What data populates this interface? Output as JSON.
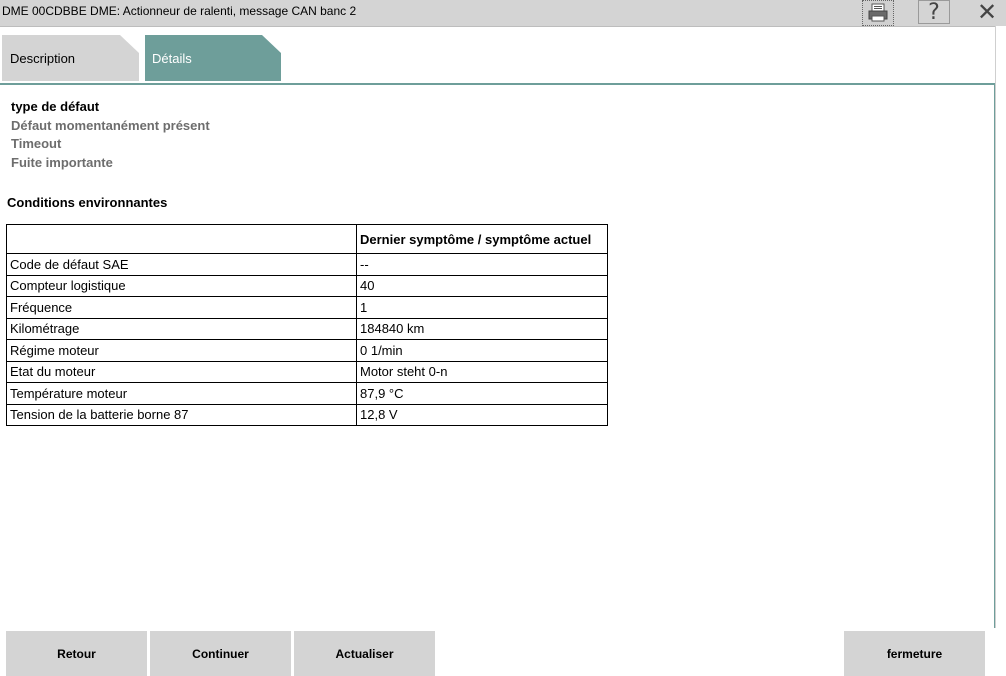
{
  "window": {
    "title": "DME 00CDBBE DME: Actionneur de ralenti, message CAN banc 2"
  },
  "toolbar": {
    "print_icon": "printer-icon",
    "help_glyph": "?",
    "close_glyph": "✕"
  },
  "tabs": [
    {
      "label": "Description"
    },
    {
      "label": "Détails"
    }
  ],
  "fault_type": {
    "title": "type de défaut",
    "items": [
      "Défaut momentanément présent",
      "Timeout",
      "Fuite importante"
    ]
  },
  "environment": {
    "title": "Conditions environnantes",
    "header": [
      "",
      "Dernier symptôme / symptôme actuel"
    ],
    "rows": [
      [
        "Code de défaut SAE",
        "--"
      ],
      [
        "Compteur logistique",
        "40"
      ],
      [
        "Fréquence",
        "1"
      ],
      [
        "Kilométrage",
        "184840 km"
      ],
      [
        "Régime moteur",
        "0 1/min"
      ],
      [
        "Etat du moteur",
        "Motor steht 0-n"
      ],
      [
        "Température moteur",
        "87,9 °C"
      ],
      [
        "Tension de la batterie borne 87",
        "12,8 V"
      ]
    ]
  },
  "buttons": {
    "back": "Retour",
    "continue": "Continuer",
    "refresh": "Actualiser",
    "close": "fermeture"
  },
  "colors": {
    "accent": "#6e9e9a",
    "tab_inactive": "#d4d4d4",
    "button_bg": "#d4d4d4"
  }
}
